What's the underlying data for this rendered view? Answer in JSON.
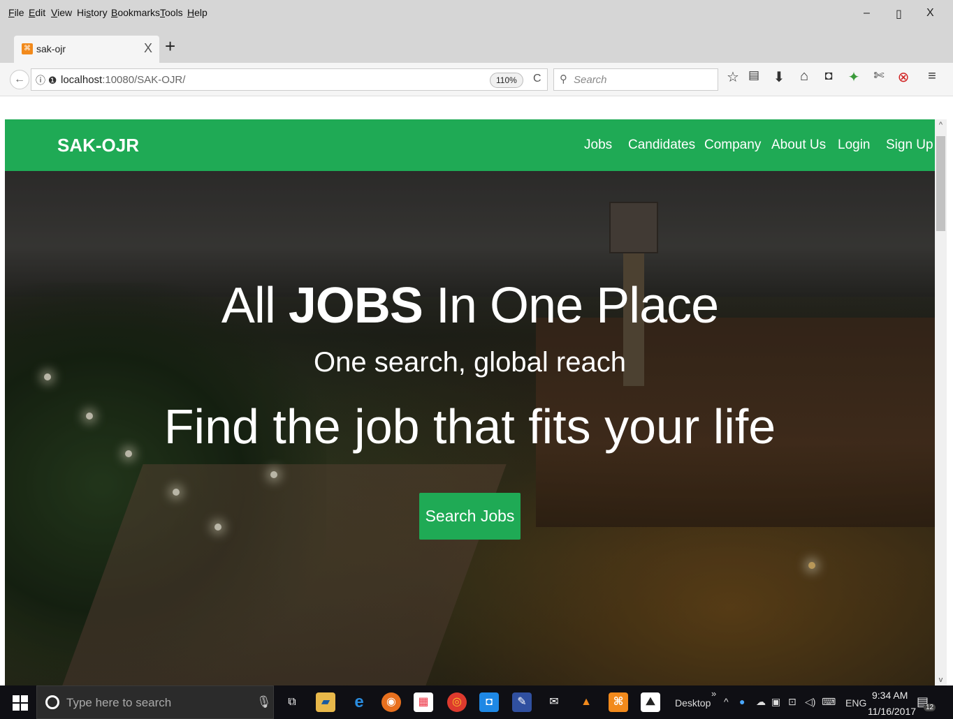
{
  "menubar": {
    "items": [
      "File",
      "Edit",
      "View",
      "History",
      "Bookmarks",
      "Tools",
      "Help"
    ],
    "accelerators": [
      "F",
      "E",
      "V",
      "s",
      "B",
      "T",
      "H"
    ],
    "window_controls": {
      "minimize": "–",
      "restore": "▯",
      "close": "X"
    }
  },
  "tab": {
    "title": "sak-ojr",
    "close": "X",
    "new_tab": "+"
  },
  "navbar": {
    "back": "←",
    "url_host": "localhost",
    "url_rest": ":10080/SAK-OJR/",
    "zoom": "110%",
    "reload": "C",
    "search_placeholder": "Search"
  },
  "toolbar_icons": [
    "bookmark-star-icon",
    "reader-list-icon",
    "download-icon",
    "home-icon",
    "pocket-icon",
    "extension-badge-icon",
    "screenshot-icon",
    "blocker-icon",
    "menu-icon"
  ],
  "site": {
    "brand": "SAK-OJR",
    "nav": [
      "Jobs",
      "Candidates",
      "Company",
      "About Us",
      "Login",
      "Sign Up"
    ],
    "headline_pre": "All ",
    "headline_bold": "JOBS",
    "headline_post": " In One Place",
    "subline": "One search, global reach",
    "tagline": "Find the job that fits your life",
    "cta": "Search Jobs",
    "accent_color": "#1faa55"
  },
  "taskbar": {
    "search_placeholder": "Type here to search",
    "desktop_label": "Desktop",
    "chevrons": "»",
    "language": "ENG",
    "time": "9:34 AM",
    "date": "11/16/2017",
    "notification_count": "12"
  }
}
